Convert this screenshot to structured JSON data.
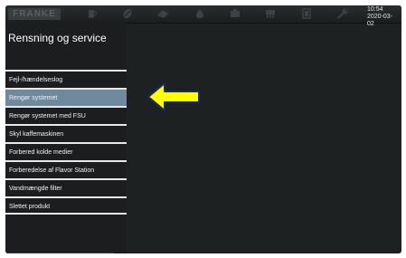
{
  "statusbar": {
    "logo": "FRANKE",
    "time": "10:54",
    "date": "2020-03-02",
    "icons": [
      "cup-icon",
      "beans-icon",
      "milk-icon",
      "drop-icon",
      "brew-unit-icon",
      "grinder-icon",
      "door-icon",
      "wrench-icon"
    ]
  },
  "sidebar": {
    "title": "Rensning og service",
    "items": [
      {
        "label": "Fejl-/hændelseslog"
      },
      {
        "label": "Rengør systemet"
      },
      {
        "label": "Rengør systemet med FSU"
      },
      {
        "label": "Skyl kaffemaskinen"
      },
      {
        "label": "Forbered kolde medier"
      },
      {
        "label": "Forberedelse af Flavor Station"
      },
      {
        "label": "Vandmængde filter"
      },
      {
        "label": "Slettet produkt"
      }
    ],
    "selected_index": 1
  },
  "colors": {
    "highlight": "#6e8a9c",
    "arrow_fill": "#ffff00",
    "arrow_stroke": "#1b2a6b"
  }
}
